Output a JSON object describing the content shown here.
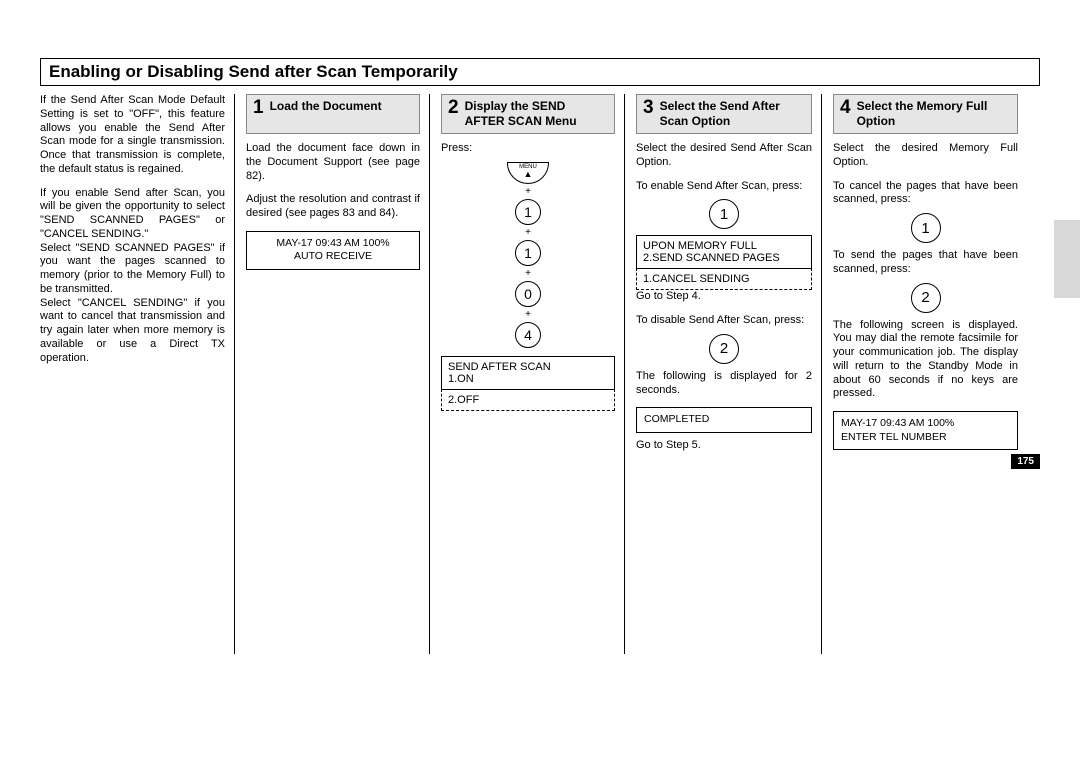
{
  "title": "Enabling or Disabling Send after Scan Temporarily",
  "intro": {
    "p1": "If the Send After Scan Mode Default Setting is set to \"OFF\", this feature allows you enable the Send After Scan mode for a single transmission. Once that transmission is complete, the default status is regained.",
    "p2": "If you enable Send after Scan, you will be given the opportunity to select \"SEND SCANNED PAGES\" or \"CANCEL SEND­ING.\"",
    "p3": "Select \"SEND SCANNED PAG­ES\" if you want the pages scanned to memory (prior to the Memory Full) to be transmitted.",
    "p4": "Select \"CANCEL SENDING\" if you want to cancel that trans­mission and try again later when more memory is available or use a Direct TX operation."
  },
  "step1": {
    "num": "1",
    "title": "Load the Document",
    "p1": "Load the document face down in the Document Support (see page 82).",
    "p2": "Adjust the resolution and con­trast if desired (see pages 83 and 84).",
    "lcd1a": "MAY-17 09:43 AM 100%",
    "lcd1b": "AUTO RECEIVE"
  },
  "step2": {
    "num": "2",
    "title": "Display the SEND AFTER SCAN Menu",
    "press": "Press:",
    "menu": "MENU",
    "k1": "1",
    "k2": "1",
    "k3": "0",
    "k4": "4",
    "plus": "+",
    "lcd_top": "SEND AFTER SCAN\n1.ON",
    "lcd_bot": "2.OFF"
  },
  "step3": {
    "num": "3",
    "title": "Select the Send After Scan Option",
    "p1": "Select the desired Send After Scan Option.",
    "p2": "To enable Send After Scan, press:",
    "k_enable": "1",
    "lcd_top": "UPON MEMORY FULL\n2.SEND SCANNED PAGES",
    "lcd_bot": "1.CANCEL SENDING",
    "p3": "Go to Step 4.",
    "p4": "To disable Send After Scan, press:",
    "k_disable": "2",
    "p5": "The following is displayed for 2 seconds.",
    "lcd2": "COMPLETED",
    "p6": "Go to Step 5."
  },
  "step4": {
    "num": "4",
    "title": "Select the Memory Full Option",
    "p1": "Select the desired Memory Full Option.",
    "p2": "To cancel the pages that have been scanned, press:",
    "k_cancel": "1",
    "p3": "To send the pages that have been scanned, press:",
    "k_send": "2",
    "p4": "The following screen is dis­played. You may dial the remote facsimile for your communica­tion job. The display will return to the Standby Mode in about 60 seconds if no keys are pressed.",
    "lcd_a": "MAY-17 09:43 AM 100%",
    "lcd_b": "ENTER TEL NUMBER"
  },
  "page_number": "175"
}
